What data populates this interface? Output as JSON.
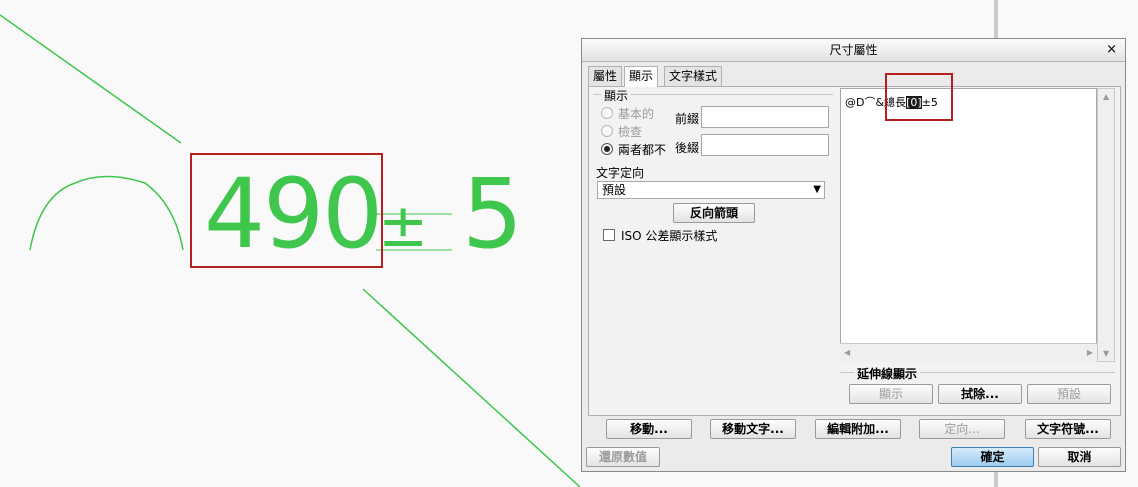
{
  "canvas": {
    "dimension_value": "490",
    "plus_minus": "±",
    "tolerance": "5",
    "line_color": "#3fc64c",
    "highlight_color": "#b32020"
  },
  "dialog": {
    "title": "尺寸屬性",
    "close_icon": "×",
    "tabs": [
      "屬性",
      "顯示",
      "文字樣式"
    ],
    "active_tab": "顯示",
    "display_group": {
      "title": "顯示",
      "radios": [
        {
          "label": "基本的",
          "checked": false,
          "enabled": false
        },
        {
          "label": "檢查",
          "checked": false,
          "enabled": false
        },
        {
          "label": "兩者都不",
          "checked": true,
          "enabled": true
        }
      ],
      "prefix_label": "前綴",
      "prefix_value": "",
      "suffix_label": "後綴",
      "suffix_value": "",
      "orientation_label": "文字定向",
      "orientation_value": "預設",
      "reverse_arrows_button": "反向箭頭",
      "iso_label": "ISO 公差顯示樣式",
      "iso_checked": false
    },
    "text_editor": {
      "text_prefix": "@D",
      "text_symbol": "⌒",
      "text_mid": "&總長",
      "text_selected": "[0]",
      "text_suffix": "±5"
    },
    "witness_group": {
      "title": "延伸線顯示",
      "show_button": "顯示",
      "erase_button": "拭除...",
      "default_button": "預設"
    },
    "bottom_buttons": {
      "move": "移動...",
      "move_text": "移動文字...",
      "edit_attach": "編輯附加...",
      "orient": "定向...",
      "text_symbol": "文字符號...",
      "restore": "還原數值",
      "ok": "確定",
      "cancel": "取消"
    }
  }
}
